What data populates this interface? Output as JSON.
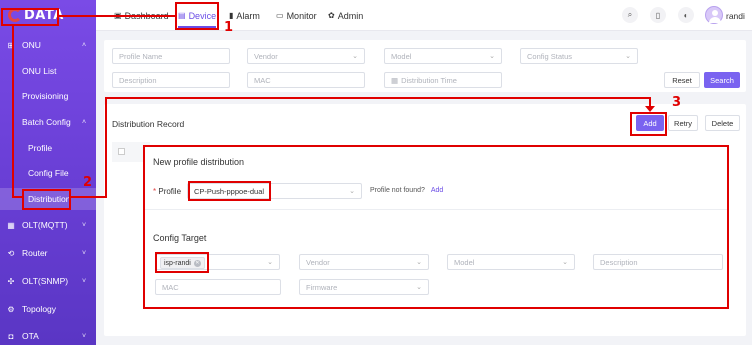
{
  "brand": {
    "logo_text": "DATA"
  },
  "topnav": {
    "items": [
      {
        "label": "Dashboard",
        "icon": "dashboard-icon"
      },
      {
        "label": "Device",
        "icon": "device-icon"
      },
      {
        "label": "Alarm",
        "icon": "alarm-icon"
      },
      {
        "label": "Monitor",
        "icon": "monitor-icon"
      },
      {
        "label": "Admin",
        "icon": "admin-icon"
      }
    ],
    "active": "Device",
    "username": "randi"
  },
  "sidebar": {
    "items": [
      {
        "label": "ONU",
        "icon": "onu-icon"
      },
      {
        "label": "ONU List"
      },
      {
        "label": "Provisioning"
      },
      {
        "label": "Batch Config"
      },
      {
        "label": "Profile"
      },
      {
        "label": "Config File"
      },
      {
        "label": "Distribution"
      },
      {
        "label": "OLT(MQTT)",
        "icon": "olt-icon"
      },
      {
        "label": "Router",
        "icon": "router-icon"
      },
      {
        "label": "OLT(SNMP)",
        "icon": "olt-snmp-icon"
      },
      {
        "label": "Topology",
        "icon": "topology-icon"
      },
      {
        "label": "OTA",
        "icon": "ota-icon"
      }
    ],
    "active": "Distribution"
  },
  "filters": {
    "profile_name": "Profile Name",
    "vendor": "Vendor",
    "model": "Model",
    "config_status": "Config Status",
    "description": "Description",
    "mac": "MAC",
    "distribution_time": "Distribution Time",
    "reset": "Reset",
    "search": "Search"
  },
  "distribution": {
    "title": "Distribution Record",
    "add": "Add",
    "retry": "Retry",
    "delete": "Delete"
  },
  "modal": {
    "title": "New profile distribution",
    "profile_label": "Profile",
    "profile_required_mark": "*",
    "profile_value": "CP-Push-pppoe-dual",
    "profile_hint": "Profile not found?",
    "profile_hint_link": "Add",
    "config_target_title": "Config Target",
    "tag_value": "isp-randi",
    "vendor": "Vendor",
    "model": "Model",
    "description": "Description",
    "mac": "MAC",
    "firmware": "Firmware"
  },
  "annotations": {
    "step1": "1",
    "step2": "2",
    "step3": "3"
  },
  "colors": {
    "accent": "#7a63f0",
    "sidebar": "#6a3fd6",
    "annotation": "#e00000"
  }
}
